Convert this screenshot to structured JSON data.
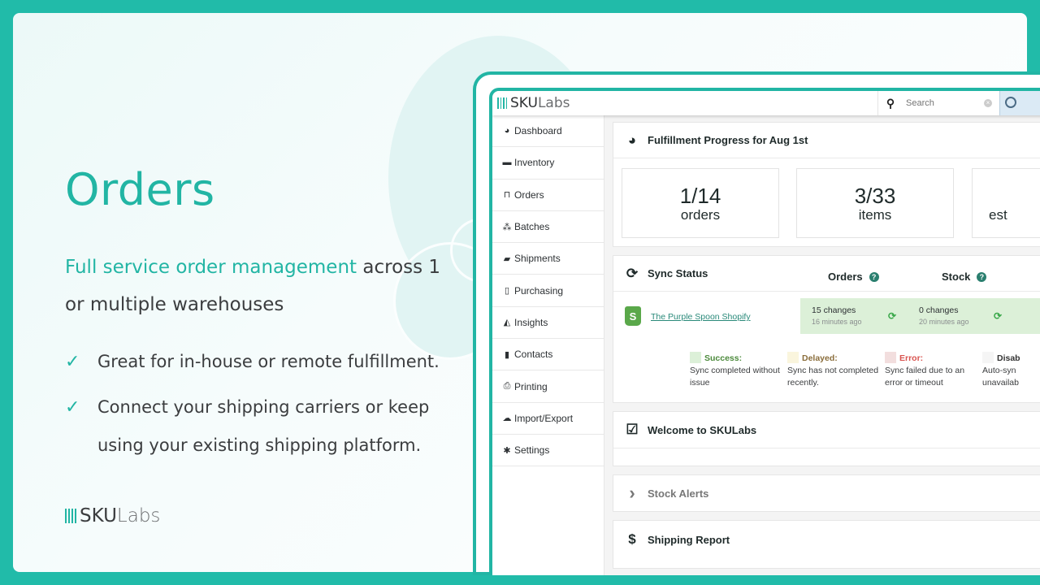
{
  "marketing": {
    "headline": "Orders",
    "subhead_accent": "Full service order management",
    "subhead_rest": " across 1 or multiple warehouses",
    "bullets": [
      {
        "icon": "check-icon",
        "text": "Great for in-house or remote fulfillment."
      },
      {
        "icon": "check-icon",
        "text": "Connect your shipping carriers or keep using your existing shipping platform."
      }
    ],
    "brand_sku": "SKU",
    "brand_labs": "Labs"
  },
  "app": {
    "logo_sku": "SKU",
    "logo_labs": "Labs",
    "search_placeholder": "Search",
    "sidebar": [
      {
        "icon": "dashboard-icon",
        "glyph": "◕",
        "label": "Dashboard"
      },
      {
        "icon": "archive-icon",
        "glyph": "▬",
        "label": "Inventory"
      },
      {
        "icon": "basket-icon",
        "glyph": "⊓",
        "label": "Orders"
      },
      {
        "icon": "cubes-icon",
        "glyph": "⁂",
        "label": "Batches"
      },
      {
        "icon": "truck-icon",
        "glyph": "▰",
        "label": "Shipments"
      },
      {
        "icon": "file-icon",
        "glyph": "▯",
        "label": "Purchasing"
      },
      {
        "icon": "area-chart-icon",
        "glyph": "◭",
        "label": "Insights"
      },
      {
        "icon": "address-book-icon",
        "glyph": "▮",
        "label": "Contacts"
      },
      {
        "icon": "print-icon",
        "glyph": "⎙",
        "label": "Printing"
      },
      {
        "icon": "cloud-upload-icon",
        "glyph": "☁",
        "label": "Import/Export"
      },
      {
        "icon": "gear-icon",
        "glyph": "✱",
        "label": "Settings"
      }
    ],
    "fulfillment": {
      "title": "Fulfillment Progress for Aug 1st",
      "stats": [
        {
          "value": "1/14",
          "unit": "orders"
        },
        {
          "value": "3/33",
          "unit": "items"
        },
        {
          "value": "",
          "unit": "est"
        }
      ]
    },
    "sync": {
      "title": "Sync Status",
      "col_orders": "Orders",
      "col_stock": "Stock",
      "store": "The Purple Spoon Shopify",
      "orders_changes": "15 changes",
      "orders_time": "16 minutes ago",
      "stock_changes": "0 changes",
      "stock_time": "20 minutes ago",
      "legend": [
        {
          "label": "Success:",
          "desc": "Sync completed without issue",
          "color": "#dcf0d8",
          "text_color": "#4c8a3c"
        },
        {
          "label": "Delayed:",
          "desc": "Sync has not completed recently.",
          "color": "#faf5dd",
          "text_color": "#8a6d3b"
        },
        {
          "label": "Error:",
          "desc": "Sync failed due to an error or timeout",
          "color": "#f2dede",
          "text_color": "#d9534f"
        },
        {
          "label": "Disab",
          "desc": "Auto-syn unavailab",
          "color": "#f5f5f5",
          "text_color": "#333333"
        }
      ]
    },
    "welcome": {
      "title": "Welcome to SKULabs"
    },
    "stock_alerts": {
      "title": "Stock Alerts"
    },
    "shipping_report": {
      "title": "Shipping Report"
    }
  }
}
